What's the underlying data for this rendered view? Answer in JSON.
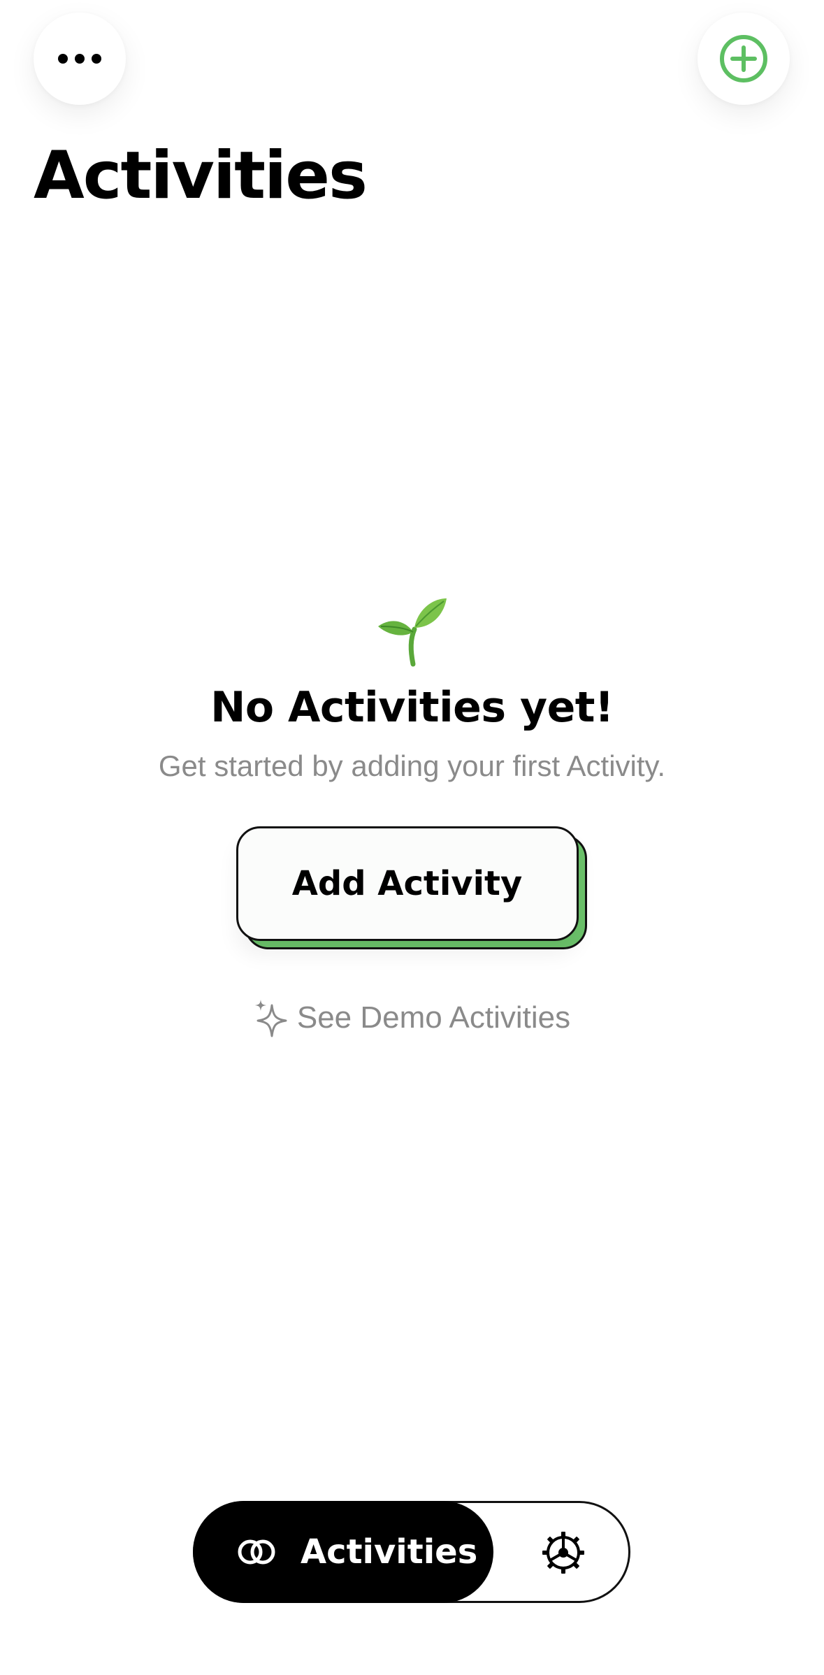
{
  "header": {
    "title": "Activities",
    "more_icon": "ellipsis-icon",
    "add_icon": "plus-circle-icon"
  },
  "empty_state": {
    "icon": "seedling-icon",
    "title": "No Activities yet!",
    "subtitle": "Get started by adding your first Activity.",
    "add_button_label": "Add Activity",
    "demo_icon": "sparkles-icon",
    "demo_link_label": "See Demo Activities"
  },
  "tab_bar": {
    "tabs": [
      {
        "label": "Activities",
        "icon": "overlapping-circles-icon",
        "selected": true
      },
      {
        "label": "",
        "icon": "gear-icon",
        "selected": false
      }
    ]
  },
  "colors": {
    "accent_green": "#6cc36b",
    "text_primary": "#000000",
    "text_secondary": "#8a8a8a",
    "background": "#ffffff"
  }
}
